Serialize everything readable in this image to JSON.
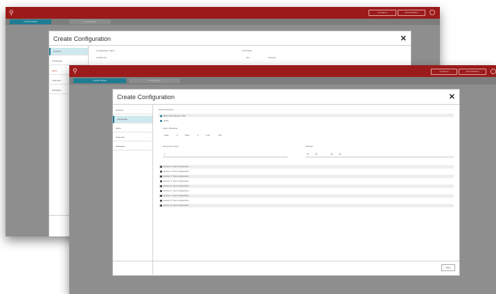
{
  "app": {
    "logo_glyph": "⚲",
    "toolbar_buttons": [
      "Configure",
      "Administration"
    ],
    "tabs": [
      "Control Center",
      "Configuration"
    ]
  },
  "dialog": {
    "title": "Create Configuration",
    "close_glyph": "✕",
    "sidebar_items": [
      "General",
      "Thresholds",
      "Alerts",
      "Channels",
      "Packages"
    ],
    "save_label": "Save"
  },
  "back_dialog": {
    "fields": {
      "config_name_label": "Configuration Name",
      "config_name_value": "Untitled (2)",
      "lock_label": "Lock Mode",
      "option_1": "Yes",
      "option_2": "Network"
    }
  },
  "front_dialog": {
    "section_title": "Planned Actions",
    "action_1": "Block all Changes: OFF",
    "action_2": "Notify",
    "schedule_label": "Alarm Schedule",
    "schedule_values": [
      "Daily",
      "Daily",
      "1:00",
      "AM"
    ],
    "recurrence_label": "Recurrence Type",
    "recurrence_value": "1",
    "window_label": "Window",
    "window_values": [
      "1h",
      "2h",
      "3m",
      "4m"
    ],
    "packages": [
      "Device 1: Test configuration",
      "Device 2: Test configuration",
      "Device 3: Test configuration",
      "Device 4: Test configuration",
      "Device 5: Test configuration",
      "Device 6: Test configuration",
      "Device 7: Test configuration",
      "Device 8: Test configuration",
      "Device 9: Test configuration"
    ]
  },
  "colors": {
    "titlebar": "#9b1b1b",
    "accent": "#1e7d93",
    "backdrop": "#8e8e8e"
  }
}
